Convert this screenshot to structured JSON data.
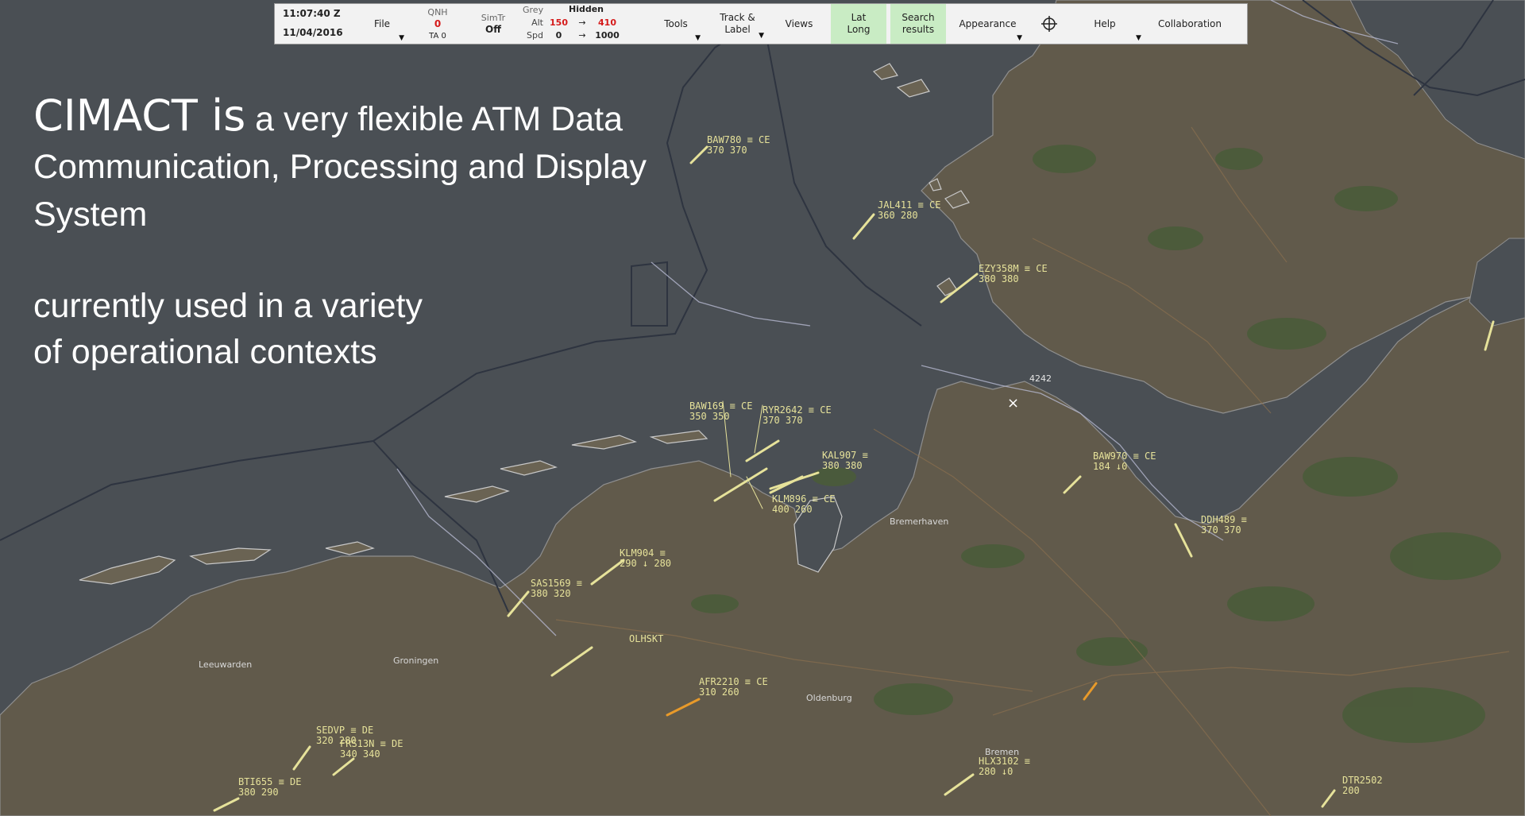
{
  "toolbar": {
    "time": "11:07:40 Z",
    "date": "11/04/2016",
    "file": "File",
    "qnh_label": "QNH",
    "qnh_value": "0",
    "ta_value": "TA 0",
    "simtr_label": "SimTr",
    "simtr_value": "Off",
    "grey_label": "Grey",
    "hidden_label": "Hidden",
    "alt_label": "Alt",
    "alt_min": "150",
    "alt_max": "410",
    "spd_label": "Spd",
    "spd_min": "0",
    "spd_max": "1000",
    "range_arrow": "→",
    "tools": "Tools",
    "track_label_line1": "Track &",
    "track_label_line2": "Label",
    "views": "Views",
    "latlong_line1": "Lat",
    "latlong_line2": "Long",
    "search_line1": "Search",
    "search_line2": "results",
    "appearance": "Appearance",
    "crosshair_icon": "crosshair-icon",
    "help": "Help",
    "collaboration": "Collaboration",
    "dropdown_glyph": "▼"
  },
  "overlay": {
    "headline_big": "CIMACT is",
    "headline_rest": " a very flexible ATM Data",
    "headline_line2": "Communication, Processing and Display",
    "headline_line3": "System",
    "sub_line1": "currently used in a variety",
    "sub_line2": "of operational contexts"
  },
  "colors": {
    "sea": "#4a4f54",
    "land": "#615a4b",
    "green_area": "#4a5b3a",
    "track_yellow": "#e6e29a",
    "track_orange": "#e89a2a",
    "track_green": "#37d23a",
    "alt_red": "#d51a1a",
    "toolbar_green": "#c9ecc4"
  },
  "tracks": [
    {
      "id": "BAW780",
      "line1": "BAW780 ≡ CE",
      "line2": "370 370",
      "color": "yellow"
    },
    {
      "id": "JAL411",
      "line1": "JAL411 ≡ CE",
      "line2": "360 280",
      "color": "yellow"
    },
    {
      "id": "EZY358M",
      "line1": "EZY358M ≡ CE",
      "line2": "380 380",
      "color": "yellow"
    },
    {
      "id": "BAW169",
      "line1": "BAW169 ≡ CE",
      "line2": "350 350",
      "color": "yellow"
    },
    {
      "id": "RYR2642",
      "line1": "RYR2642 ≡ CE",
      "line2": "370 370",
      "color": "yellow"
    },
    {
      "id": "KAL907",
      "line1": "KAL907 ≡",
      "line2": "380 380",
      "color": "yellow"
    },
    {
      "id": "KLM896",
      "line1": "KLM896 ≡ CE",
      "line2": "400 260",
      "color": "yellow"
    },
    {
      "id": "BAW970",
      "line1": "BAW970 ≡ CE",
      "line2": "184 ↓0",
      "color": "yellow"
    },
    {
      "id": "DDH489",
      "line1": "DDH489 ≡",
      "line2": "370 370",
      "color": "yellow"
    },
    {
      "id": "KLM904",
      "line1": "KLM904 ≡",
      "line2": "290 ↓ 280",
      "color": "yellow"
    },
    {
      "id": "SAS1569",
      "line1": "SAS1569 ≡",
      "line2": "380 320",
      "color": "yellow"
    },
    {
      "id": "OLHSKT",
      "line1": "OLHSKT",
      "line2": "",
      "color": "yellow"
    },
    {
      "id": "AFR2210",
      "line1": "AFR2210 ≡ CE",
      "line2": "310 260",
      "color": "yellow"
    },
    {
      "id": "SEDVP",
      "line1": "SEDVP ≡ DE",
      "line2": "320 280",
      "color": "yellow"
    },
    {
      "id": "FRS13N",
      "line1": "FRS13N ≡ DE",
      "line2": "340 340",
      "color": "yellow"
    },
    {
      "id": "BTI655",
      "line1": "BTI655 ≡ DE",
      "line2": "380 290",
      "color": "yellow"
    },
    {
      "id": "HLX3102",
      "line1": "HLX3102 ≡",
      "line2": "280 ↓0",
      "color": "yellow"
    },
    {
      "id": "DTR2502",
      "line1": "DTR2502",
      "line2": "200",
      "color": "yellow"
    }
  ],
  "map_labels": {
    "city_bremen": "Bremen",
    "city_groningen": "Groningen",
    "city_leeuwarden": "Leeuwarden",
    "city_oldenburg": "Oldenburg",
    "city_bremerhaven": "Bremerhaven",
    "nav_4242": "4242"
  }
}
